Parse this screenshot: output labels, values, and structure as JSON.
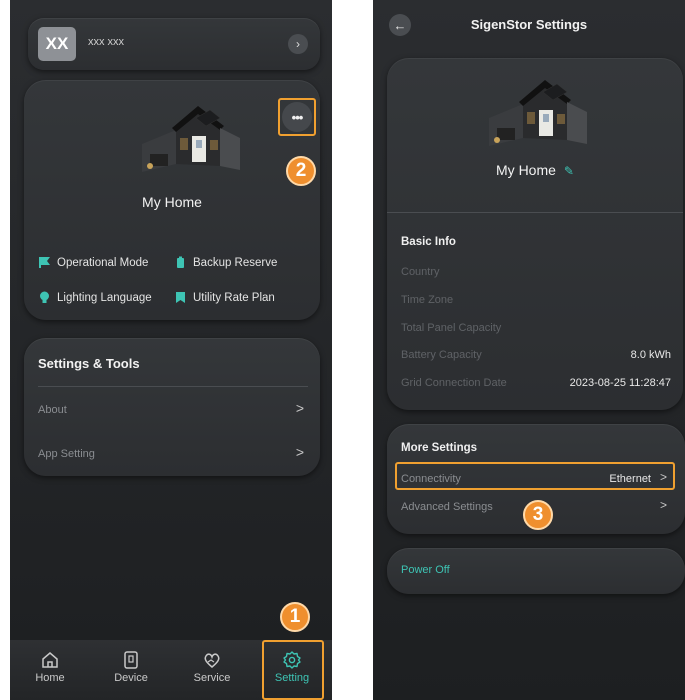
{
  "left": {
    "user": {
      "avatar_text": "XX",
      "name": "xxx xxx",
      "chevron": "›"
    },
    "home": {
      "more_icon": "•••",
      "title": "My Home",
      "features": [
        {
          "label": "Operational Mode",
          "icon": "flag-icon",
          "color": "#3ec4b4"
        },
        {
          "label": "Backup Reserve",
          "icon": "battery-icon",
          "color": "#3ec4b4"
        },
        {
          "label": "Lighting Language",
          "icon": "bulb-icon",
          "color": "#3ec4b4"
        },
        {
          "label": "Utility Rate Plan",
          "icon": "bookmark-icon",
          "color": "#3ec4b4"
        }
      ]
    },
    "tools": {
      "title": "Settings & Tools",
      "items": [
        {
          "label": "About",
          "chevron": ">"
        },
        {
          "label": "App Setting",
          "chevron": ">"
        }
      ]
    },
    "tabs": [
      {
        "label": "Home",
        "icon": "home-icon",
        "active": false
      },
      {
        "label": "Device",
        "icon": "device-icon",
        "active": false
      },
      {
        "label": "Service",
        "icon": "service-icon",
        "active": false
      },
      {
        "label": "Setting",
        "icon": "gear-icon",
        "active": true
      }
    ],
    "callouts": {
      "one": "1",
      "two": "2"
    }
  },
  "right": {
    "back_icon": "←",
    "title": "SigenStor Settings",
    "home_title": "My Home",
    "basic": {
      "title": "Basic Info",
      "rows": [
        {
          "label": "Country",
          "value": ""
        },
        {
          "label": "Time Zone",
          "value": ""
        },
        {
          "label": "Total Panel Capacity",
          "value": ""
        },
        {
          "label": "Battery Capacity",
          "value": "8.0 kWh"
        },
        {
          "label": "Grid Connection Date",
          "value": "2023-08-25 11:28:47"
        }
      ]
    },
    "more": {
      "title": "More Settings",
      "connectivity": {
        "label": "Connectivity",
        "value": "Ethernet",
        "chevron": ">"
      },
      "advanced": {
        "label": "Advanced Settings",
        "chevron": ">"
      }
    },
    "power_off": "Power Off",
    "callouts": {
      "three": "3"
    }
  },
  "colors": {
    "accent": "#3ec4b4",
    "highlight": "#f0a030",
    "badge": "#ef8f2e"
  }
}
